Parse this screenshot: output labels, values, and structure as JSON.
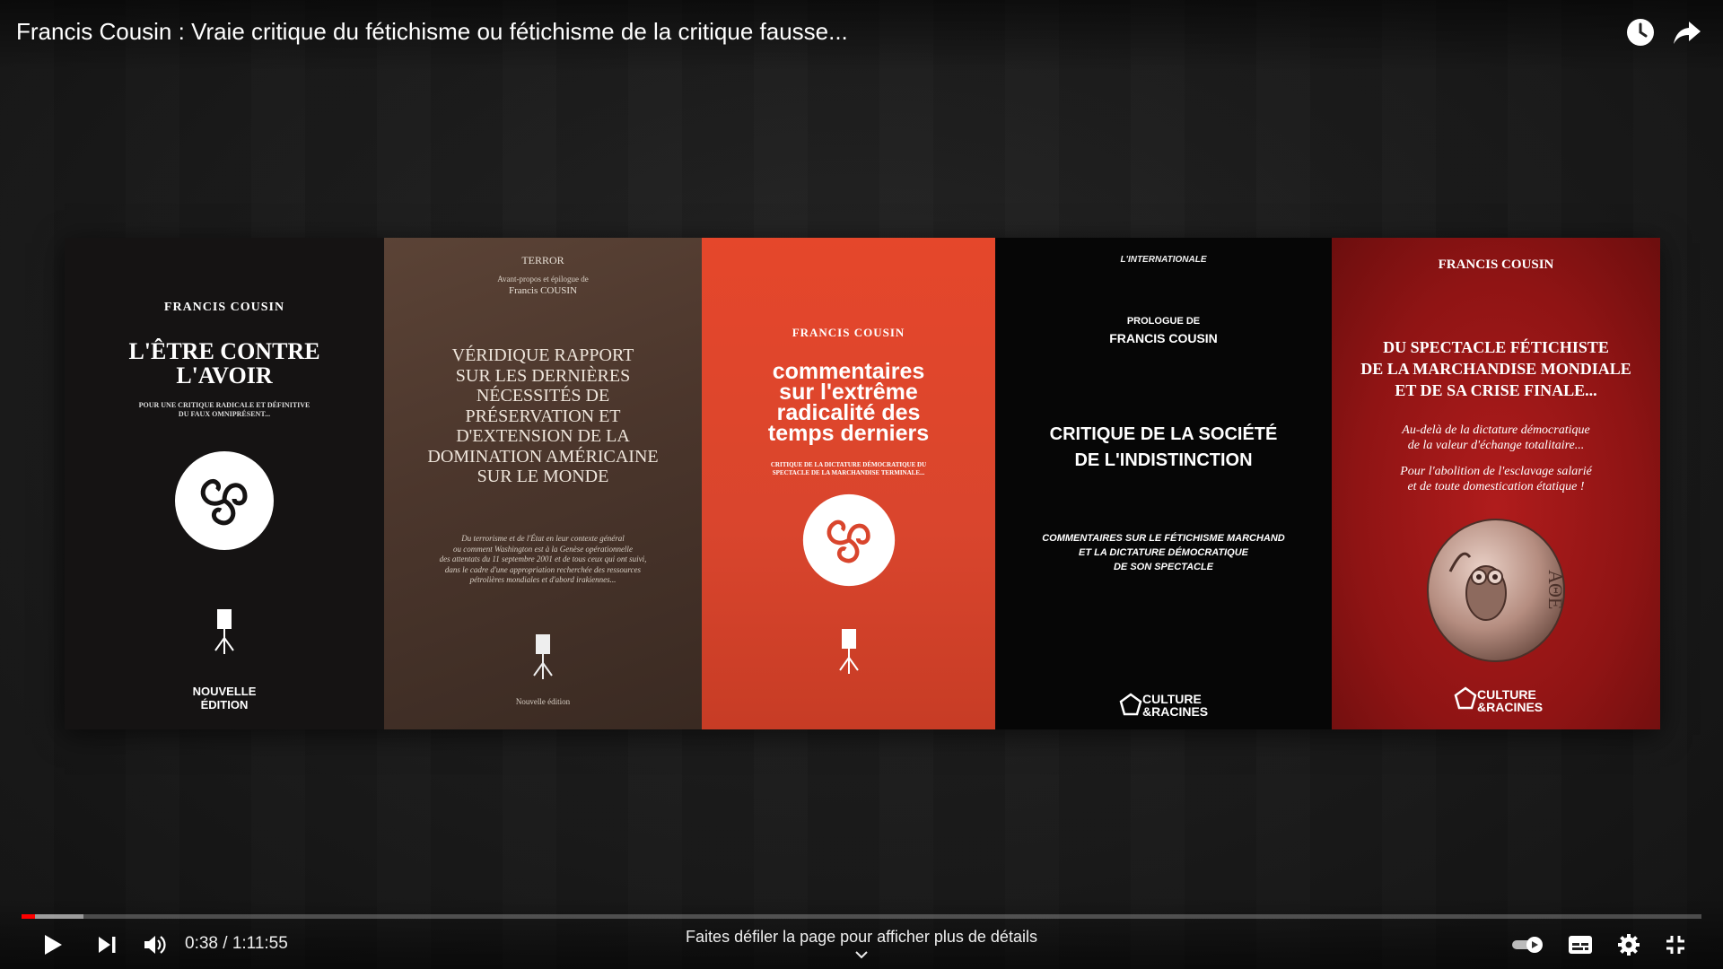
{
  "video": {
    "title": "Francis Cousin : Vraie critique du fétichisme ou fétichisme de la critique fausse...",
    "progress_played": 0.008,
    "progress_buffered": 0.037
  },
  "top_actions": {
    "watch_later_icon": "clock-icon",
    "share_icon": "share-arrow-icon"
  },
  "books": [
    {
      "author": "FRANCIS COUSIN",
      "title_line1": "L'ÊTRE CONTRE",
      "title_line2": "L'AVOIR",
      "subtitle_line1": "POUR UNE CRITIQUE RADICALE ET DÉFINITIVE",
      "subtitle_line2": "DU FAUX OMNIPRÉSENT...",
      "edition_line1": "NOUVELLE",
      "edition_line2": "ÉDITION"
    },
    {
      "author": "TERROR",
      "preface_line1": "Avant-propos et épilogue de",
      "preface_line2": "Francis COUSIN",
      "title_lines": [
        "VÉRIDIQUE RAPPORT",
        "SUR LES DERNIÈRES",
        "NÉCESSITÉS DE",
        "PRÉSERVATION ET",
        "D'EXTENSION DE LA",
        "DOMINATION AMÉRICAINE",
        "SUR LE MONDE"
      ],
      "blurb_lines": [
        "Du terrorisme et de l'État en leur contexte général",
        "ou comment Washington est à la Genèse opérationnelle",
        "des attentats du 11 septembre 2001 et de tous ceux qui ont suivi,",
        "dans le cadre d'une appropriation recherchée des ressources",
        "pétrolières mondiales et d'abord irakiennes..."
      ],
      "edition": "Nouvelle édition"
    },
    {
      "author": "FRANCIS COUSIN",
      "title_lines": [
        "commentaires",
        "sur l'extrême",
        "radicalité des",
        "temps derniers"
      ],
      "subtitle_line1": "CRITIQUE DE LA DICTATURE DÉMOCRATIQUE DU",
      "subtitle_line2": "SPECTACLE DE LA MARCHANDISE TERMINALE..."
    },
    {
      "publisher_top": "L'INTERNATIONALE",
      "prologue_line1": "PROLOGUE DE",
      "prologue_line2": "FRANCIS COUSIN",
      "title_line1": "CRITIQUE DE LA SOCIÉTÉ",
      "title_line2": "DE L'INDISTINCTION",
      "subtitle_lines": [
        "COMMENTAIRES SUR LE FÉTICHISME MARCHAND",
        "ET LA DICTATURE DÉMOCRATIQUE",
        "DE SON SPECTACLE"
      ],
      "publisher_line1": "CULTURE",
      "publisher_line2": "&RACINES"
    },
    {
      "author": "FRANCIS COUSIN",
      "title_lines": [
        "DU SPECTACLE FÉTICHISTE",
        "DE LA MARCHANDISE MONDIALE",
        "ET DE SA CRISE FINALE..."
      ],
      "tagline_lines": [
        "Au-delà de la dictature démocratique",
        "de la valeur d'échange totalitaire...",
        "",
        "Pour l'abolition de l'esclavage salarié",
        "et de toute domestication étatique !"
      ],
      "coin_text": "ΑΘΕ",
      "publisher_line1": "CULTURE",
      "publisher_line2": "&RACINES"
    }
  ],
  "controls": {
    "current_time": "0:38",
    "duration": "1:11:55",
    "time_display": "0:38 / 1:11:55",
    "scroll_hint": "Faites défiler la page pour afficher plus de détails",
    "icons": [
      "play-icon",
      "next-icon",
      "volume-icon",
      "autoplay-toggle-icon",
      "subtitles-icon",
      "settings-gear-icon",
      "exit-fullscreen-icon"
    ]
  }
}
